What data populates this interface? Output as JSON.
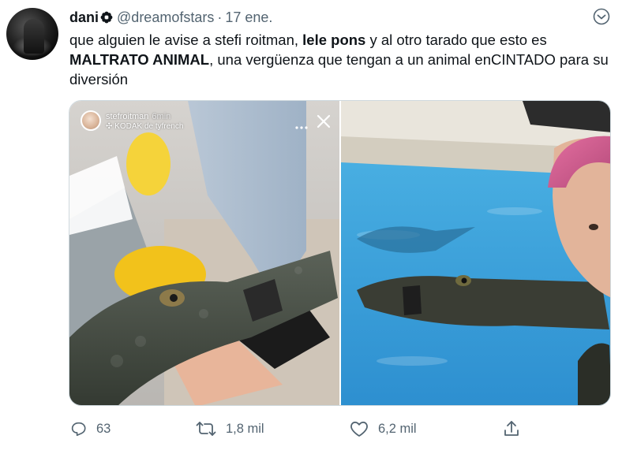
{
  "tweet": {
    "author_name": "dani",
    "author_handle": "@dreamofstars",
    "separator": "·",
    "date": "17 ene.",
    "text_part1": "que alguien le avise a stefi roitman, ",
    "text_bold1": "lele pons",
    "text_part2": " y al otro tarado que esto es ",
    "text_bold2": "MALTRATO ANIMAL",
    "text_part3": ", una vergüenza que tengan a un animal enCINTADO para su diversión"
  },
  "media": {
    "story": {
      "username": "stefroitman",
      "time": "6min",
      "music": "✣ KODAK de tyfrench"
    }
  },
  "actions": {
    "reply_count": "63",
    "retweet_count": "1,8 mil",
    "like_count": "6,2 mil"
  },
  "icons": {
    "badge": "flower-badge-icon",
    "more": "more-icon",
    "reply": "reply-icon",
    "retweet": "retweet-icon",
    "like": "heart-icon",
    "share": "share-icon",
    "story_close": "close-icon"
  },
  "colors": {
    "text": "#0f1419",
    "secondary": "#536471",
    "border": "#cfd9de"
  }
}
